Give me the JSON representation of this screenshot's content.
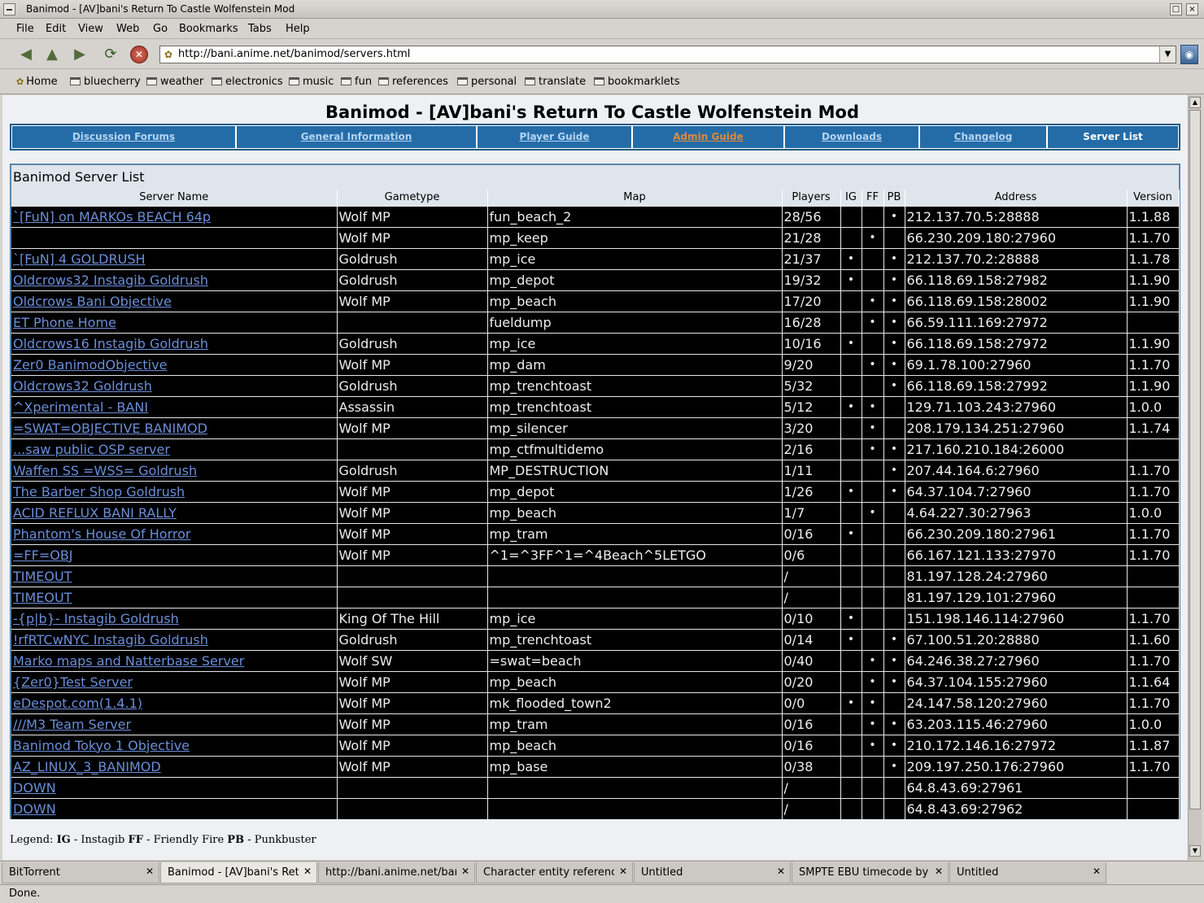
{
  "window": {
    "title": "Banimod - [AV]bani's Return To Castle Wolfenstein Mod"
  },
  "menu": [
    "File",
    "Edit",
    "View",
    "Web",
    "Go",
    "Bookmarks",
    "Tabs",
    "Help"
  ],
  "toolbar": {
    "url": "http://bani.anime.net/banimod/servers.html"
  },
  "bookmarks": {
    "home": "Home",
    "folders": [
      "bluecherry",
      "weather",
      "electronics",
      "music",
      "fun",
      "references",
      "personal",
      "translate",
      "bookmarklets"
    ]
  },
  "page": {
    "title": "Banimod - [AV]bani's Return To Castle Wolfenstein Mod",
    "nav": [
      "Discussion Forums",
      "General Information",
      "Player Guide",
      "Admin Guide",
      "Downloads",
      "Changelog",
      "Server List"
    ],
    "list_caption": "Banimod Server List",
    "columns": [
      "Server Name",
      "Gametype",
      "Map",
      "Players",
      "IG",
      "FF",
      "PB",
      "Address",
      "Version"
    ],
    "rows": [
      [
        "`[FuN] on MARKOs BEACH 64p",
        "Wolf MP",
        "fun_beach_2",
        "28/56",
        "",
        "",
        "•",
        "212.137.70.5:28888",
        "1.1.88"
      ],
      [
        "",
        "Wolf MP",
        "mp_keep",
        "21/28",
        "",
        "•",
        "",
        "66.230.209.180:27960",
        "1.1.70"
      ],
      [
        "`[FuN] 4 GOLDRUSH",
        "Goldrush",
        "mp_ice",
        "21/37",
        "•",
        "",
        "•",
        "212.137.70.2:28888",
        "1.1.78"
      ],
      [
        "Oldcrows32 Instagib Goldrush",
        "Goldrush",
        "mp_depot",
        "19/32",
        "•",
        "",
        "•",
        "66.118.69.158:27982",
        "1.1.90"
      ],
      [
        "Oldcrows Bani Objective",
        "Wolf MP",
        "mp_beach",
        "17/20",
        "",
        "•",
        "•",
        "66.118.69.158:28002",
        "1.1.90"
      ],
      [
        "ET Phone Home",
        "",
        "fueldump",
        "16/28",
        "",
        "•",
        "•",
        "66.59.111.169:27972",
        ""
      ],
      [
        "Oldcrows16 Instagib Goldrush",
        "Goldrush",
        "mp_ice",
        "10/16",
        "•",
        "",
        "•",
        "66.118.69.158:27972",
        "1.1.90"
      ],
      [
        "Zer0 BanimodObjective",
        "Wolf MP",
        "mp_dam",
        "9/20",
        "",
        "•",
        "•",
        "69.1.78.100:27960",
        "1.1.70"
      ],
      [
        "Oldcrows32 Goldrush",
        "Goldrush",
        "mp_trenchtoast",
        "5/32",
        "",
        "",
        "•",
        "66.118.69.158:27992",
        "1.1.90"
      ],
      [
        "^Xperimental - BANI",
        "Assassin",
        "mp_trenchtoast",
        "5/12",
        "•",
        "•",
        "",
        "129.71.103.243:27960",
        "1.0.0"
      ],
      [
        "=SWAT=OBJECTIVE BANIMOD",
        "Wolf MP",
        "mp_silencer",
        "3/20",
        "",
        "•",
        "",
        "208.179.134.251:27960",
        "1.1.74"
      ],
      [
        "...saw public OSP server",
        "",
        "mp_ctfmultidemo",
        "2/16",
        "",
        "•",
        "•",
        "217.160.210.184:26000",
        ""
      ],
      [
        "Waffen SS =WSS= Goldrush",
        "Goldrush",
        "MP_DESTRUCTION",
        "1/11",
        "",
        "",
        "•",
        "207.44.164.6:27960",
        "1.1.70"
      ],
      [
        "The Barber Shop Goldrush",
        "Wolf MP",
        "mp_depot",
        "1/26",
        "•",
        "",
        "•",
        "64.37.104.7:27960",
        "1.1.70"
      ],
      [
        "ACID REFLUX BANI RALLY",
        "Wolf MP",
        "mp_beach",
        "1/7",
        "",
        "•",
        "",
        "4.64.227.30:27963",
        "1.0.0"
      ],
      [
        "Phantom's House Of Horror",
        "Wolf MP",
        "mp_tram",
        "0/16",
        "•",
        "",
        "",
        "66.230.209.180:27961",
        "1.1.70"
      ],
      [
        "=FF=OBJ",
        "Wolf MP",
        "^1=^3FF^1=^4Beach^5LETGO",
        "0/6",
        "",
        "",
        "",
        "66.167.121.133:27970",
        "1.1.70"
      ],
      [
        "TIMEOUT",
        "",
        "",
        "/",
        "",
        "",
        "",
        "81.197.128.24:27960",
        ""
      ],
      [
        "TIMEOUT",
        "",
        "",
        "/",
        "",
        "",
        "",
        "81.197.129.101:27960",
        ""
      ],
      [
        "-{p|b}- Instagib Goldrush",
        "King Of The Hill",
        "mp_ice",
        "0/10",
        "•",
        "",
        "",
        "151.198.146.114:27960",
        "1.1.70"
      ],
      [
        "!rfRTCwNYC Instagib Goldrush",
        "Goldrush",
        "mp_trenchtoast",
        "0/14",
        "•",
        "",
        "•",
        "67.100.51.20:28880",
        "1.1.60"
      ],
      [
        "Marko maps and Natterbase Server",
        "Wolf SW",
        "=swat=beach",
        "0/40",
        "",
        "•",
        "•",
        "64.246.38.27:27960",
        "1.1.70"
      ],
      [
        "{Zer0}Test Server",
        "Wolf MP",
        "mp_beach",
        "0/20",
        "",
        "•",
        "•",
        "64.37.104.155:27960",
        "1.1.64"
      ],
      [
        "eDespot.com(1.4.1)",
        "Wolf MP",
        "mk_flooded_town2",
        "0/0",
        "•",
        "•",
        "",
        "24.147.58.120:27960",
        "1.1.70"
      ],
      [
        "///M3 Team Server",
        "Wolf MP",
        "mp_tram",
        "0/16",
        "",
        "•",
        "•",
        "63.203.115.46:27960",
        "1.0.0"
      ],
      [
        "Banimod Tokyo 1 Objective",
        "Wolf MP",
        "mp_beach",
        "0/16",
        "",
        "•",
        "•",
        "210.172.146.16:27972",
        "1.1.87"
      ],
      [
        "AZ_LINUX_3_BANIMOD",
        "Wolf MP",
        "mp_base",
        "0/38",
        "",
        "",
        "•",
        "209.197.250.176:27960",
        "1.1.70"
      ],
      [
        "DOWN",
        "",
        "",
        "/",
        "",
        "",
        "",
        "64.8.43.69:27961",
        ""
      ],
      [
        "DOWN",
        "",
        "",
        "/",
        "",
        "",
        "",
        "64.8.43.69:27962",
        ""
      ]
    ],
    "legend": {
      "label": "Legend:",
      "ig_key": "IG",
      "ig_text": "- Instagib",
      "ff_key": "FF",
      "ff_text": "- Friendly Fire",
      "pb_key": "PB",
      "pb_text": "- Punkbuster"
    }
  },
  "tabs": [
    "BitTorrent",
    "Banimod - [AV]bani's Return To Castle Wolfenstein Mod",
    "http://bani.anime.net/banimod/servers.html",
    "Character entity references",
    "Untitled",
    "SMPTE EBU timecode by Phil Rees",
    "Untitled"
  ],
  "status": "Done."
}
